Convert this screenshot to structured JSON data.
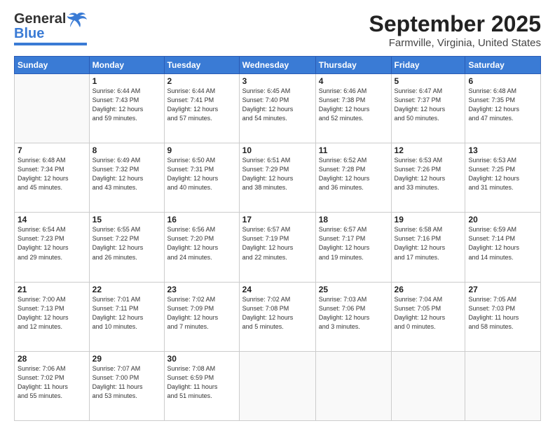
{
  "brand": {
    "name_part1": "General",
    "name_part2": "Blue"
  },
  "title": "September 2025",
  "subtitle": "Farmville, Virginia, United States",
  "weekdays": [
    "Sunday",
    "Monday",
    "Tuesday",
    "Wednesday",
    "Thursday",
    "Friday",
    "Saturday"
  ],
  "weeks": [
    [
      {
        "day": "",
        "info": ""
      },
      {
        "day": "1",
        "info": "Sunrise: 6:44 AM\nSunset: 7:43 PM\nDaylight: 12 hours\nand 59 minutes."
      },
      {
        "day": "2",
        "info": "Sunrise: 6:44 AM\nSunset: 7:41 PM\nDaylight: 12 hours\nand 57 minutes."
      },
      {
        "day": "3",
        "info": "Sunrise: 6:45 AM\nSunset: 7:40 PM\nDaylight: 12 hours\nand 54 minutes."
      },
      {
        "day": "4",
        "info": "Sunrise: 6:46 AM\nSunset: 7:38 PM\nDaylight: 12 hours\nand 52 minutes."
      },
      {
        "day": "5",
        "info": "Sunrise: 6:47 AM\nSunset: 7:37 PM\nDaylight: 12 hours\nand 50 minutes."
      },
      {
        "day": "6",
        "info": "Sunrise: 6:48 AM\nSunset: 7:35 PM\nDaylight: 12 hours\nand 47 minutes."
      }
    ],
    [
      {
        "day": "7",
        "info": "Sunrise: 6:48 AM\nSunset: 7:34 PM\nDaylight: 12 hours\nand 45 minutes."
      },
      {
        "day": "8",
        "info": "Sunrise: 6:49 AM\nSunset: 7:32 PM\nDaylight: 12 hours\nand 43 minutes."
      },
      {
        "day": "9",
        "info": "Sunrise: 6:50 AM\nSunset: 7:31 PM\nDaylight: 12 hours\nand 40 minutes."
      },
      {
        "day": "10",
        "info": "Sunrise: 6:51 AM\nSunset: 7:29 PM\nDaylight: 12 hours\nand 38 minutes."
      },
      {
        "day": "11",
        "info": "Sunrise: 6:52 AM\nSunset: 7:28 PM\nDaylight: 12 hours\nand 36 minutes."
      },
      {
        "day": "12",
        "info": "Sunrise: 6:53 AM\nSunset: 7:26 PM\nDaylight: 12 hours\nand 33 minutes."
      },
      {
        "day": "13",
        "info": "Sunrise: 6:53 AM\nSunset: 7:25 PM\nDaylight: 12 hours\nand 31 minutes."
      }
    ],
    [
      {
        "day": "14",
        "info": "Sunrise: 6:54 AM\nSunset: 7:23 PM\nDaylight: 12 hours\nand 29 minutes."
      },
      {
        "day": "15",
        "info": "Sunrise: 6:55 AM\nSunset: 7:22 PM\nDaylight: 12 hours\nand 26 minutes."
      },
      {
        "day": "16",
        "info": "Sunrise: 6:56 AM\nSunset: 7:20 PM\nDaylight: 12 hours\nand 24 minutes."
      },
      {
        "day": "17",
        "info": "Sunrise: 6:57 AM\nSunset: 7:19 PM\nDaylight: 12 hours\nand 22 minutes."
      },
      {
        "day": "18",
        "info": "Sunrise: 6:57 AM\nSunset: 7:17 PM\nDaylight: 12 hours\nand 19 minutes."
      },
      {
        "day": "19",
        "info": "Sunrise: 6:58 AM\nSunset: 7:16 PM\nDaylight: 12 hours\nand 17 minutes."
      },
      {
        "day": "20",
        "info": "Sunrise: 6:59 AM\nSunset: 7:14 PM\nDaylight: 12 hours\nand 14 minutes."
      }
    ],
    [
      {
        "day": "21",
        "info": "Sunrise: 7:00 AM\nSunset: 7:13 PM\nDaylight: 12 hours\nand 12 minutes."
      },
      {
        "day": "22",
        "info": "Sunrise: 7:01 AM\nSunset: 7:11 PM\nDaylight: 12 hours\nand 10 minutes."
      },
      {
        "day": "23",
        "info": "Sunrise: 7:02 AM\nSunset: 7:09 PM\nDaylight: 12 hours\nand 7 minutes."
      },
      {
        "day": "24",
        "info": "Sunrise: 7:02 AM\nSunset: 7:08 PM\nDaylight: 12 hours\nand 5 minutes."
      },
      {
        "day": "25",
        "info": "Sunrise: 7:03 AM\nSunset: 7:06 PM\nDaylight: 12 hours\nand 3 minutes."
      },
      {
        "day": "26",
        "info": "Sunrise: 7:04 AM\nSunset: 7:05 PM\nDaylight: 12 hours\nand 0 minutes."
      },
      {
        "day": "27",
        "info": "Sunrise: 7:05 AM\nSunset: 7:03 PM\nDaylight: 11 hours\nand 58 minutes."
      }
    ],
    [
      {
        "day": "28",
        "info": "Sunrise: 7:06 AM\nSunset: 7:02 PM\nDaylight: 11 hours\nand 55 minutes."
      },
      {
        "day": "29",
        "info": "Sunrise: 7:07 AM\nSunset: 7:00 PM\nDaylight: 11 hours\nand 53 minutes."
      },
      {
        "day": "30",
        "info": "Sunrise: 7:08 AM\nSunset: 6:59 PM\nDaylight: 11 hours\nand 51 minutes."
      },
      {
        "day": "",
        "info": ""
      },
      {
        "day": "",
        "info": ""
      },
      {
        "day": "",
        "info": ""
      },
      {
        "day": "",
        "info": ""
      }
    ]
  ]
}
